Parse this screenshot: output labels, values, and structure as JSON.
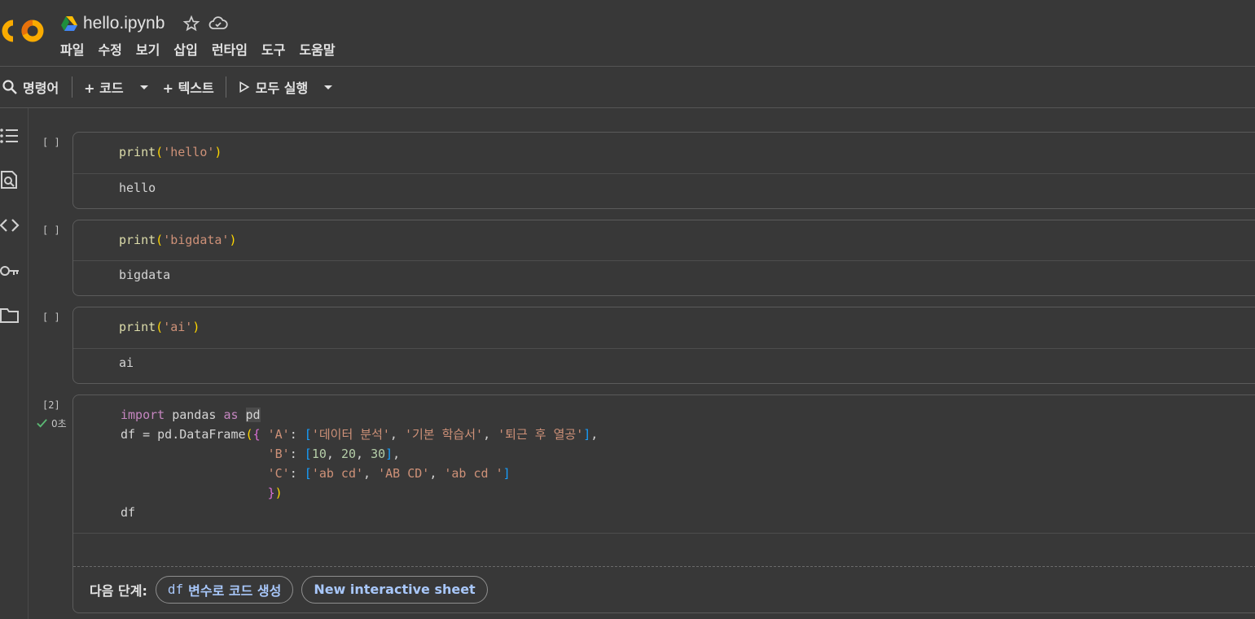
{
  "header": {
    "notebook_title": "hello.ipynb",
    "menu": [
      "파일",
      "수정",
      "보기",
      "삽입",
      "런타임",
      "도구",
      "도움말"
    ]
  },
  "toolbar": {
    "command_label": "명령어",
    "add_code_label": "+ 코드",
    "add_text_label": "+ 텍스트",
    "run_all_label": "모두 실행"
  },
  "cells": [
    {
      "exec": "[ ]",
      "code": "print('hello')",
      "output": "hello"
    },
    {
      "exec": "[ ]",
      "code": "print('bigdata')",
      "output": "bigdata"
    },
    {
      "exec": "[ ]",
      "code": "print('ai')",
      "output": "ai"
    },
    {
      "exec": "[2]",
      "status": "0초",
      "code_lines": [
        "import pandas as pd",
        "df = pd.DataFrame({ 'A': ['데이터 분석', '기본 학습서', '퇴근 후 열공'],",
        "                    'B': [10, 20, 30],",
        "                    'C': ['ab cd', 'AB CD', 'ab cd ']",
        "                    })",
        "df"
      ],
      "next_steps_label": "다음 단계:",
      "chip1_prefix": "df",
      "chip1_label": "변수로 코드 생성",
      "chip2_label": "New interactive sheet"
    }
  ],
  "colors": {
    "background": "#383838",
    "accent_link": "#a8c7fa",
    "success": "#5bb974"
  }
}
